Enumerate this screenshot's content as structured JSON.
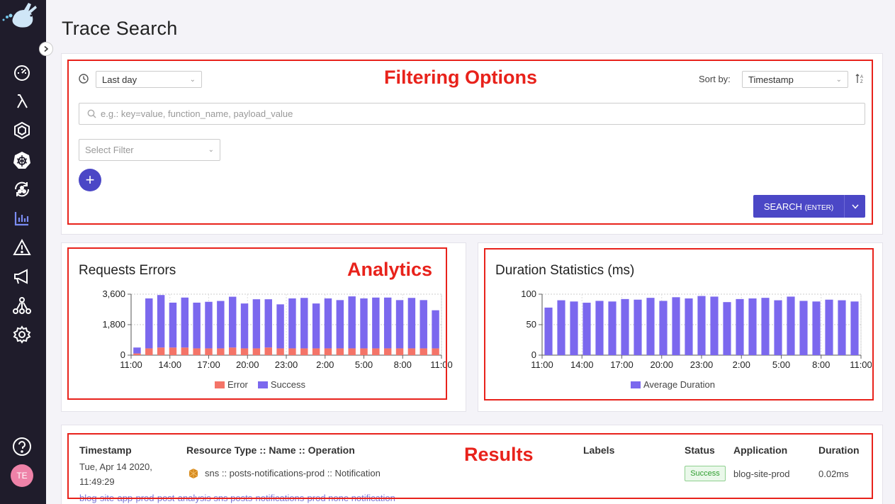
{
  "page_title": "Trace Search",
  "sidebar": {
    "items": [
      "dashboard-icon",
      "lambda-icon",
      "hexagon-icon",
      "kubernetes-icon",
      "cycle-icon",
      "analytics-icon",
      "alert-icon",
      "megaphone-icon",
      "network-icon",
      "settings-icon"
    ],
    "active": "analytics-icon",
    "avatar_initials": "TE"
  },
  "filters": {
    "time_range": "Last day",
    "sort_label": "Sort by:",
    "sort_value": "Timestamp",
    "search_placeholder": "e.g.: key=value, function_name, payload_value",
    "select_filter_placeholder": "Select Filter",
    "add_label": "+",
    "search_button": "SEARCH",
    "search_button_hint": "(ENTER)"
  },
  "annotations": {
    "filtering": "Filtering Options",
    "analytics": "Analytics",
    "results": "Results"
  },
  "colors": {
    "accent": "#4b47c6",
    "error": "#f47468",
    "success": "#7b68ee",
    "annotation": "#e8221b"
  },
  "chart_data": [
    {
      "type": "bar",
      "stacked": true,
      "title": "Requests Errors",
      "x_tick_labels": [
        "11:00",
        "14:00",
        "17:00",
        "20:00",
        "23:00",
        "2:00",
        "5:00",
        "8:00",
        "11:00"
      ],
      "y_ticks": [
        "0",
        "1,800",
        "3,600"
      ],
      "ylim": [
        0,
        3600
      ],
      "grid": true,
      "legend": "bottom",
      "series": [
        {
          "name": "Error",
          "values": [
            100,
            400,
            450,
            450,
            450,
            400,
            400,
            400,
            450,
            400,
            400,
            450,
            400,
            400,
            400,
            400,
            400,
            400,
            400,
            400,
            400,
            400,
            400,
            400,
            400,
            400
          ]
        },
        {
          "name": "Success",
          "values": [
            350,
            2950,
            3100,
            2650,
            2950,
            2700,
            2750,
            2800,
            3000,
            2650,
            2900,
            2850,
            2600,
            2950,
            2980,
            2650,
            2950,
            2850,
            3070,
            2950,
            3000,
            3000,
            2850,
            2980,
            2850,
            2250
          ]
        }
      ]
    },
    {
      "type": "bar",
      "title": "Duration Statistics (ms)",
      "x_tick_labels": [
        "11:00",
        "14:00",
        "17:00",
        "20:00",
        "23:00",
        "2:00",
        "5:00",
        "8:00",
        "11:00"
      ],
      "y_ticks": [
        "0",
        "50",
        "100"
      ],
      "ylim": [
        0,
        100
      ],
      "grid": true,
      "legend": "bottom",
      "series": [
        {
          "name": "Average Duration",
          "values": [
            78,
            90,
            88,
            86,
            89,
            88,
            92,
            91,
            94,
            89,
            95,
            93,
            97,
            96,
            87,
            92,
            93,
            94,
            90,
            96,
            89,
            88,
            91,
            90,
            88
          ]
        }
      ]
    }
  ],
  "results": {
    "headers": [
      "Timestamp",
      "Resource Type :: Name :: Operation",
      "Labels",
      "Status",
      "Application",
      "Duration"
    ],
    "rows": [
      {
        "timestamp_date": "Tue, Apr 14 2020,",
        "timestamp_time": "11:49:29",
        "resource": "sns :: posts-notifications-prod :: Notification",
        "labels": "",
        "status": "Success",
        "application": "blog-site-prod",
        "duration": "0.02ms",
        "trace_link": "blog-site-app-prod-post-analysis sns posts-notifications-prod none notification"
      }
    ]
  }
}
